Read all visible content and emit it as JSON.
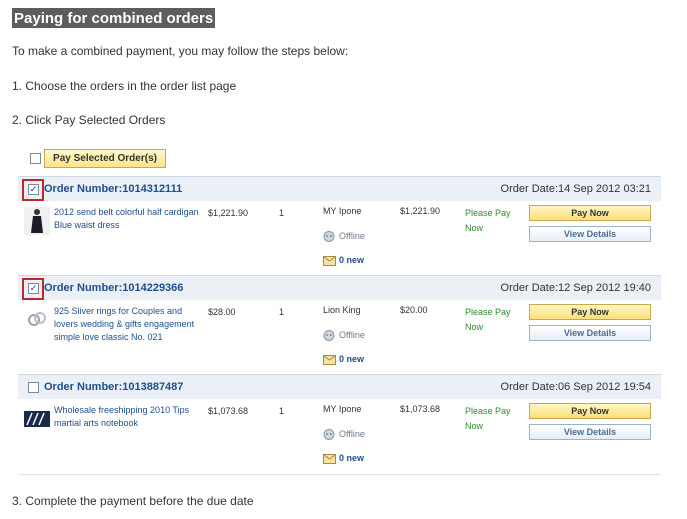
{
  "title": "Paying for combined orders",
  "intro": "To make a combined payment, you may follow the steps below:",
  "steps": {
    "s1": "1. Choose the orders in the order list page",
    "s2": "2. Click Pay Selected Orders",
    "s3": "3. Complete the payment before the due date"
  },
  "pay_selected_label": "Pay Selected Order(s)",
  "buttons": {
    "pay_now": "Pay Now",
    "view_details": "View Details"
  },
  "status_labels": {
    "offline": "Offline",
    "new": "0 new"
  },
  "orders": [
    {
      "number": "Order Number:1014312111",
      "date": "Order Date:14 Sep 2012 03:21",
      "checked": true,
      "highlighted": true,
      "product": "2012 send belt colorful half cardigan Blue waist dress",
      "price": "$1,221.90",
      "qty": "1",
      "seller": "MY Ipone",
      "total": "$1,221.90",
      "status": "Please Pay Now"
    },
    {
      "number": "Order Number:1014229366",
      "date": "Order Date:12 Sep 2012 19:40",
      "checked": true,
      "highlighted": true,
      "product": "925 Sliver rings for Couples and lovers wedding & gifts engagement simple love classic No. 021",
      "price": "$28.00",
      "qty": "1",
      "seller": "Lion King",
      "total": "$20.00",
      "status": "Please Pay Now"
    },
    {
      "number": "Order Number:1013887487",
      "date": "Order Date:06 Sep 2012 19:54",
      "checked": false,
      "highlighted": false,
      "product": "Wholesale freeshipping 2010 Tips martial arts notebook",
      "price": "$1,073.68",
      "qty": "1",
      "seller": "MY Ipone",
      "total": "$1,073.68",
      "status": "Please Pay Now"
    }
  ],
  "colors": {
    "accent_link": "#1f4e8c",
    "status_green": "#2e8b2e",
    "highlight_red": "#c0272d",
    "button_yellow": "#fbe489"
  }
}
